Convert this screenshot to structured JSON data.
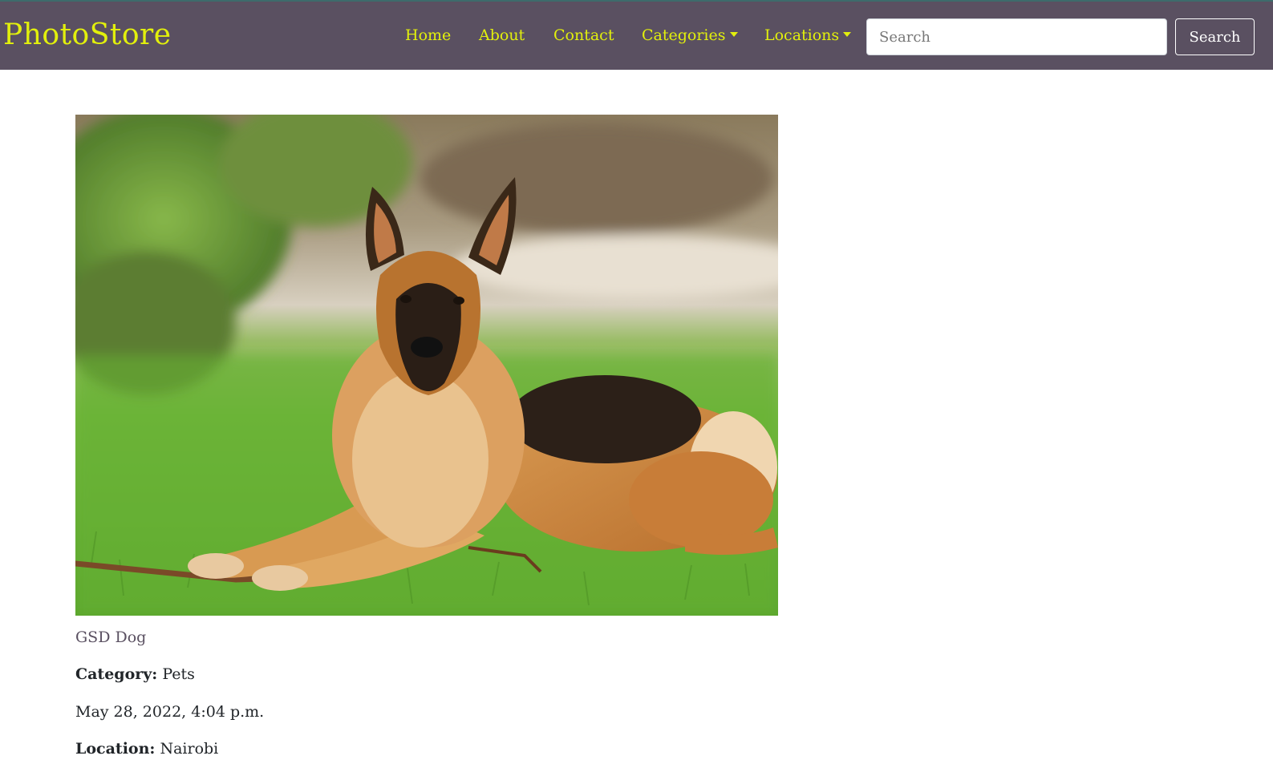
{
  "navbar": {
    "brand": "PhotoStore",
    "links": [
      {
        "label": "Home"
      },
      {
        "label": "About"
      },
      {
        "label": "Contact"
      },
      {
        "label": "Categories",
        "dropdown": true
      },
      {
        "label": "Locations",
        "dropdown": true
      }
    ],
    "search": {
      "placeholder": "Search",
      "value": "",
      "button_label": "Search"
    },
    "colors": {
      "background": "#5a5061",
      "link": "#e2f00c"
    }
  },
  "image": {
    "name": "GSD Dog",
    "category_label": "Category:",
    "category": "Pets",
    "date": "May 28, 2022, 4:04 p.m.",
    "location_label": "Location:",
    "location": "Nairobi"
  }
}
